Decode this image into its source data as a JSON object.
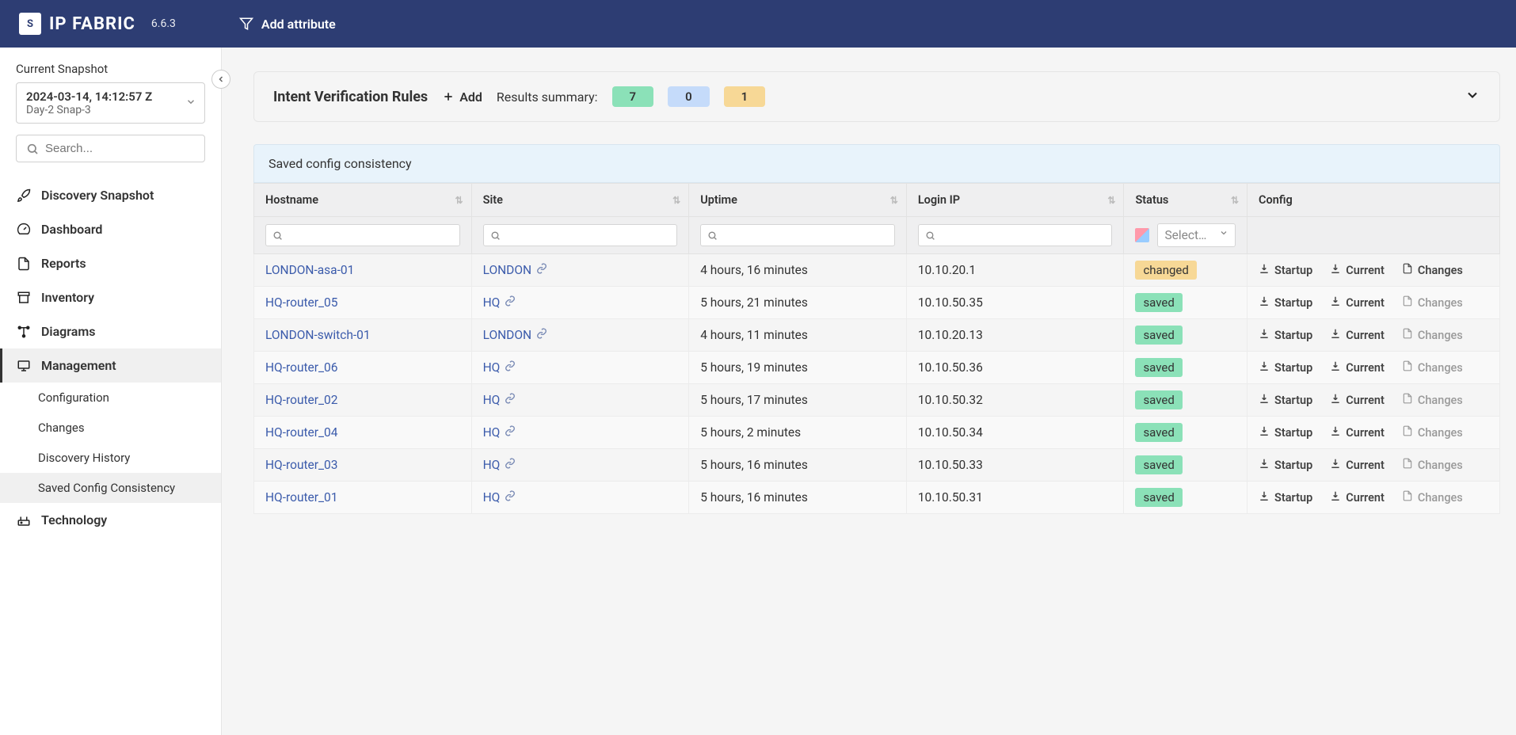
{
  "app": {
    "name": "IP FABRIC",
    "version": "6.6.3",
    "logo_mark": "S"
  },
  "header": {
    "add_attribute": "Add attribute"
  },
  "sidebar": {
    "snapshot_label": "Current Snapshot",
    "snapshot_date": "2024-03-14, 14:12:57 Z",
    "snapshot_name": "Day-2 Snap-3",
    "search_placeholder": "Search...",
    "items": [
      {
        "label": "Discovery Snapshot"
      },
      {
        "label": "Dashboard"
      },
      {
        "label": "Reports"
      },
      {
        "label": "Inventory"
      },
      {
        "label": "Diagrams"
      },
      {
        "label": "Management"
      },
      {
        "label": "Technology"
      }
    ],
    "sub_items": [
      {
        "label": "Configuration"
      },
      {
        "label": "Changes"
      },
      {
        "label": "Discovery History"
      },
      {
        "label": "Saved Config Consistency"
      }
    ]
  },
  "panel": {
    "title": "Intent Verification Rules",
    "add": "Add",
    "summary": "Results summary:",
    "green": "7",
    "blue": "0",
    "amber": "1"
  },
  "table": {
    "title": "Saved config consistency",
    "cols": {
      "hostname": "Hostname",
      "site": "Site",
      "uptime": "Uptime",
      "login_ip": "Login IP",
      "status": "Status",
      "config": "Config"
    },
    "status_placeholder": "Select…",
    "config_labels": {
      "startup": "Startup",
      "current": "Current",
      "changes": "Changes"
    },
    "rows": [
      {
        "hostname": "LONDON-asa-01",
        "site": "LONDON",
        "uptime": "4 hours, 16 minutes",
        "login_ip": "10.10.20.1",
        "status": "changed",
        "changes_active": true,
        "highlight_changes": true
      },
      {
        "hostname": "HQ-router_05",
        "site": "HQ",
        "uptime": "5 hours, 21 minutes",
        "login_ip": "10.10.50.35",
        "status": "saved",
        "changes_active": false,
        "highlight_changes": false
      },
      {
        "hostname": "LONDON-switch-01",
        "site": "LONDON",
        "uptime": "4 hours, 11 minutes",
        "login_ip": "10.10.20.13",
        "status": "saved",
        "changes_active": false,
        "highlight_changes": false
      },
      {
        "hostname": "HQ-router_06",
        "site": "HQ",
        "uptime": "5 hours, 19 minutes",
        "login_ip": "10.10.50.36",
        "status": "saved",
        "changes_active": false,
        "highlight_changes": false
      },
      {
        "hostname": "HQ-router_02",
        "site": "HQ",
        "uptime": "5 hours, 17 minutes",
        "login_ip": "10.10.50.32",
        "status": "saved",
        "changes_active": false,
        "highlight_changes": false
      },
      {
        "hostname": "HQ-router_04",
        "site": "HQ",
        "uptime": "5 hours, 2 minutes",
        "login_ip": "10.10.50.34",
        "status": "saved",
        "changes_active": false,
        "highlight_changes": false
      },
      {
        "hostname": "HQ-router_03",
        "site": "HQ",
        "uptime": "5 hours, 16 minutes",
        "login_ip": "10.10.50.33",
        "status": "saved",
        "changes_active": false,
        "highlight_changes": false
      },
      {
        "hostname": "HQ-router_01",
        "site": "HQ",
        "uptime": "5 hours, 16 minutes",
        "login_ip": "10.10.50.31",
        "status": "saved",
        "changes_active": false,
        "highlight_changes": false
      }
    ]
  }
}
